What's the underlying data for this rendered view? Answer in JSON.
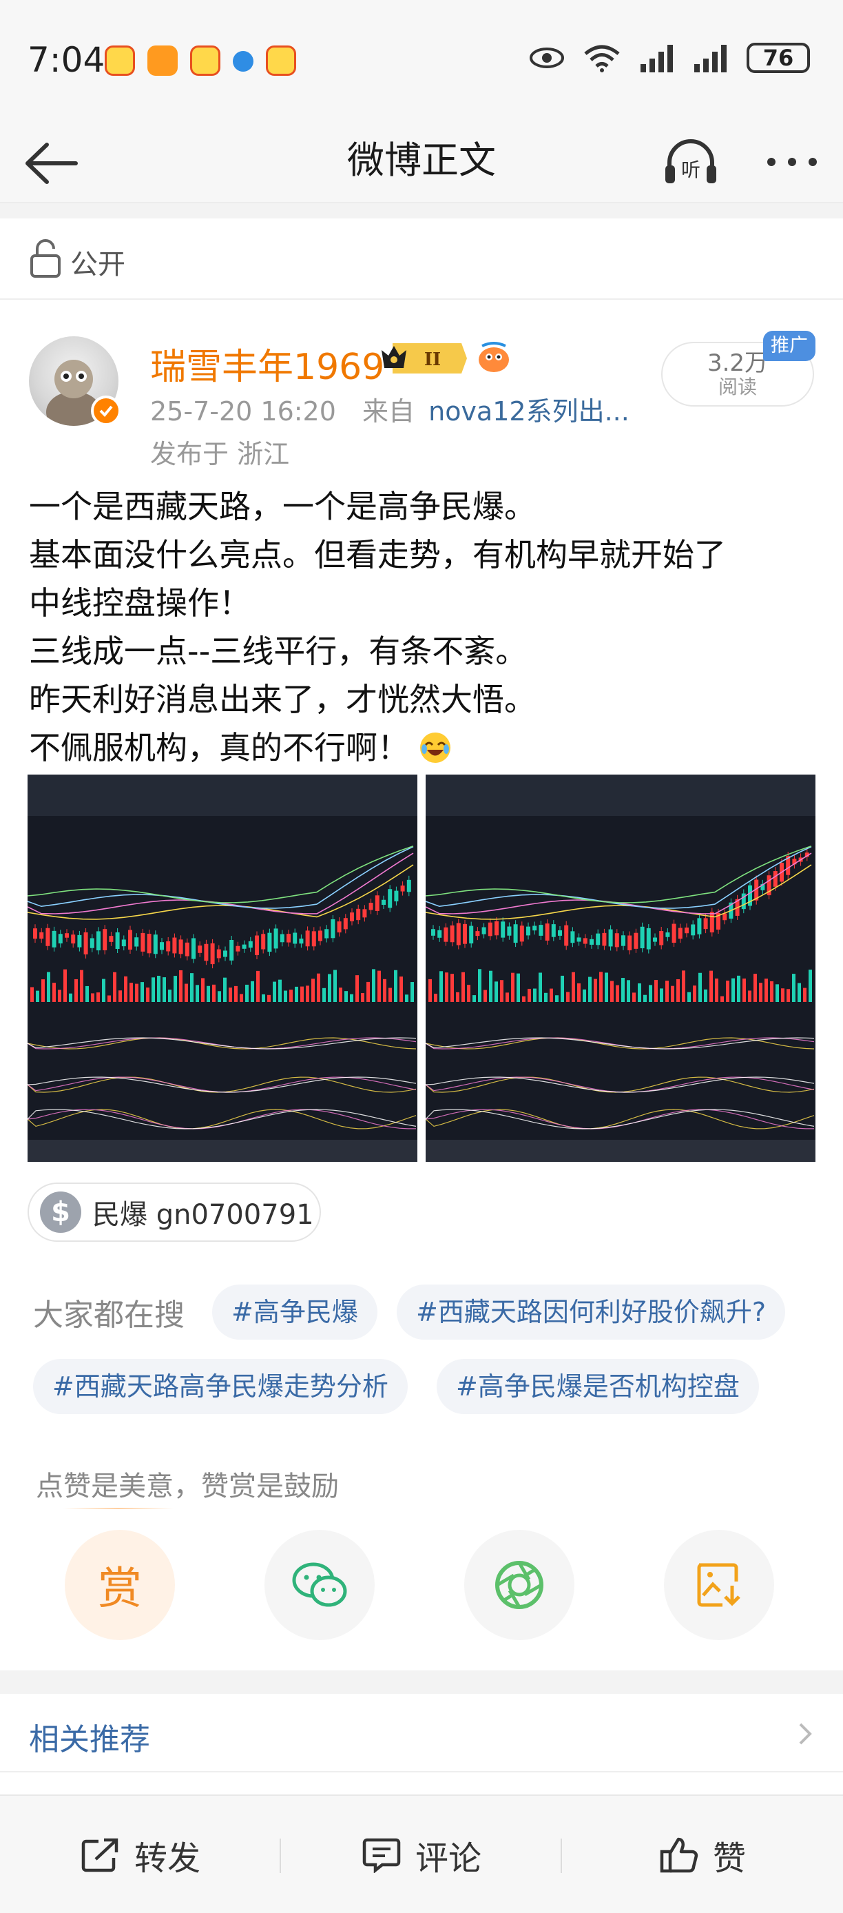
{
  "status_bar": {
    "time": "7:04",
    "battery": "76"
  },
  "nav": {
    "title": "微博正文",
    "listen_icon": "headphone-listen-icon",
    "listen_label": "听"
  },
  "visibility": {
    "label": "公开"
  },
  "post": {
    "author": "瑞雪丰年1969",
    "vip_level": "II",
    "meta": {
      "time": "25-7-20 16:20",
      "from_label": "来自",
      "source": "nova12系列出..."
    },
    "location": "发布于 浙江",
    "views": {
      "count": "3.2万",
      "label": "阅读",
      "promo_tag": "推广"
    },
    "body_lines": [
      "一个是西藏天路，一个是高争民爆。",
      "基本面没什么亮点。但看走势，有机构早就开始了",
      "中线控盘操作！",
      "三线成一点--三线平行，有条不紊。",
      "昨天利好消息出来了，才恍然大悟。",
      "不佩服机构，真的不行啊！"
    ],
    "stock_tag": {
      "symbol": "$",
      "label": "民爆 gn0700791"
    }
  },
  "hot_search": {
    "title": "大家都在搜",
    "chips": [
      "#高争民爆",
      "#西藏天路因何利好股价飙升?",
      "#西藏天路高争民爆走势分析",
      "#高争民爆是否机构控盘"
    ]
  },
  "reward": {
    "hint": "点赞是美意，赞赏是鼓励",
    "reward_char": "赏"
  },
  "related": {
    "label": "相关推荐"
  },
  "actions": {
    "repost": "转发",
    "comment": "评论",
    "like": "赞"
  },
  "colors": {
    "brand_orange": "#f07800",
    "link_blue": "#3a6aa6",
    "promo_blue": "#4d8fe0"
  }
}
